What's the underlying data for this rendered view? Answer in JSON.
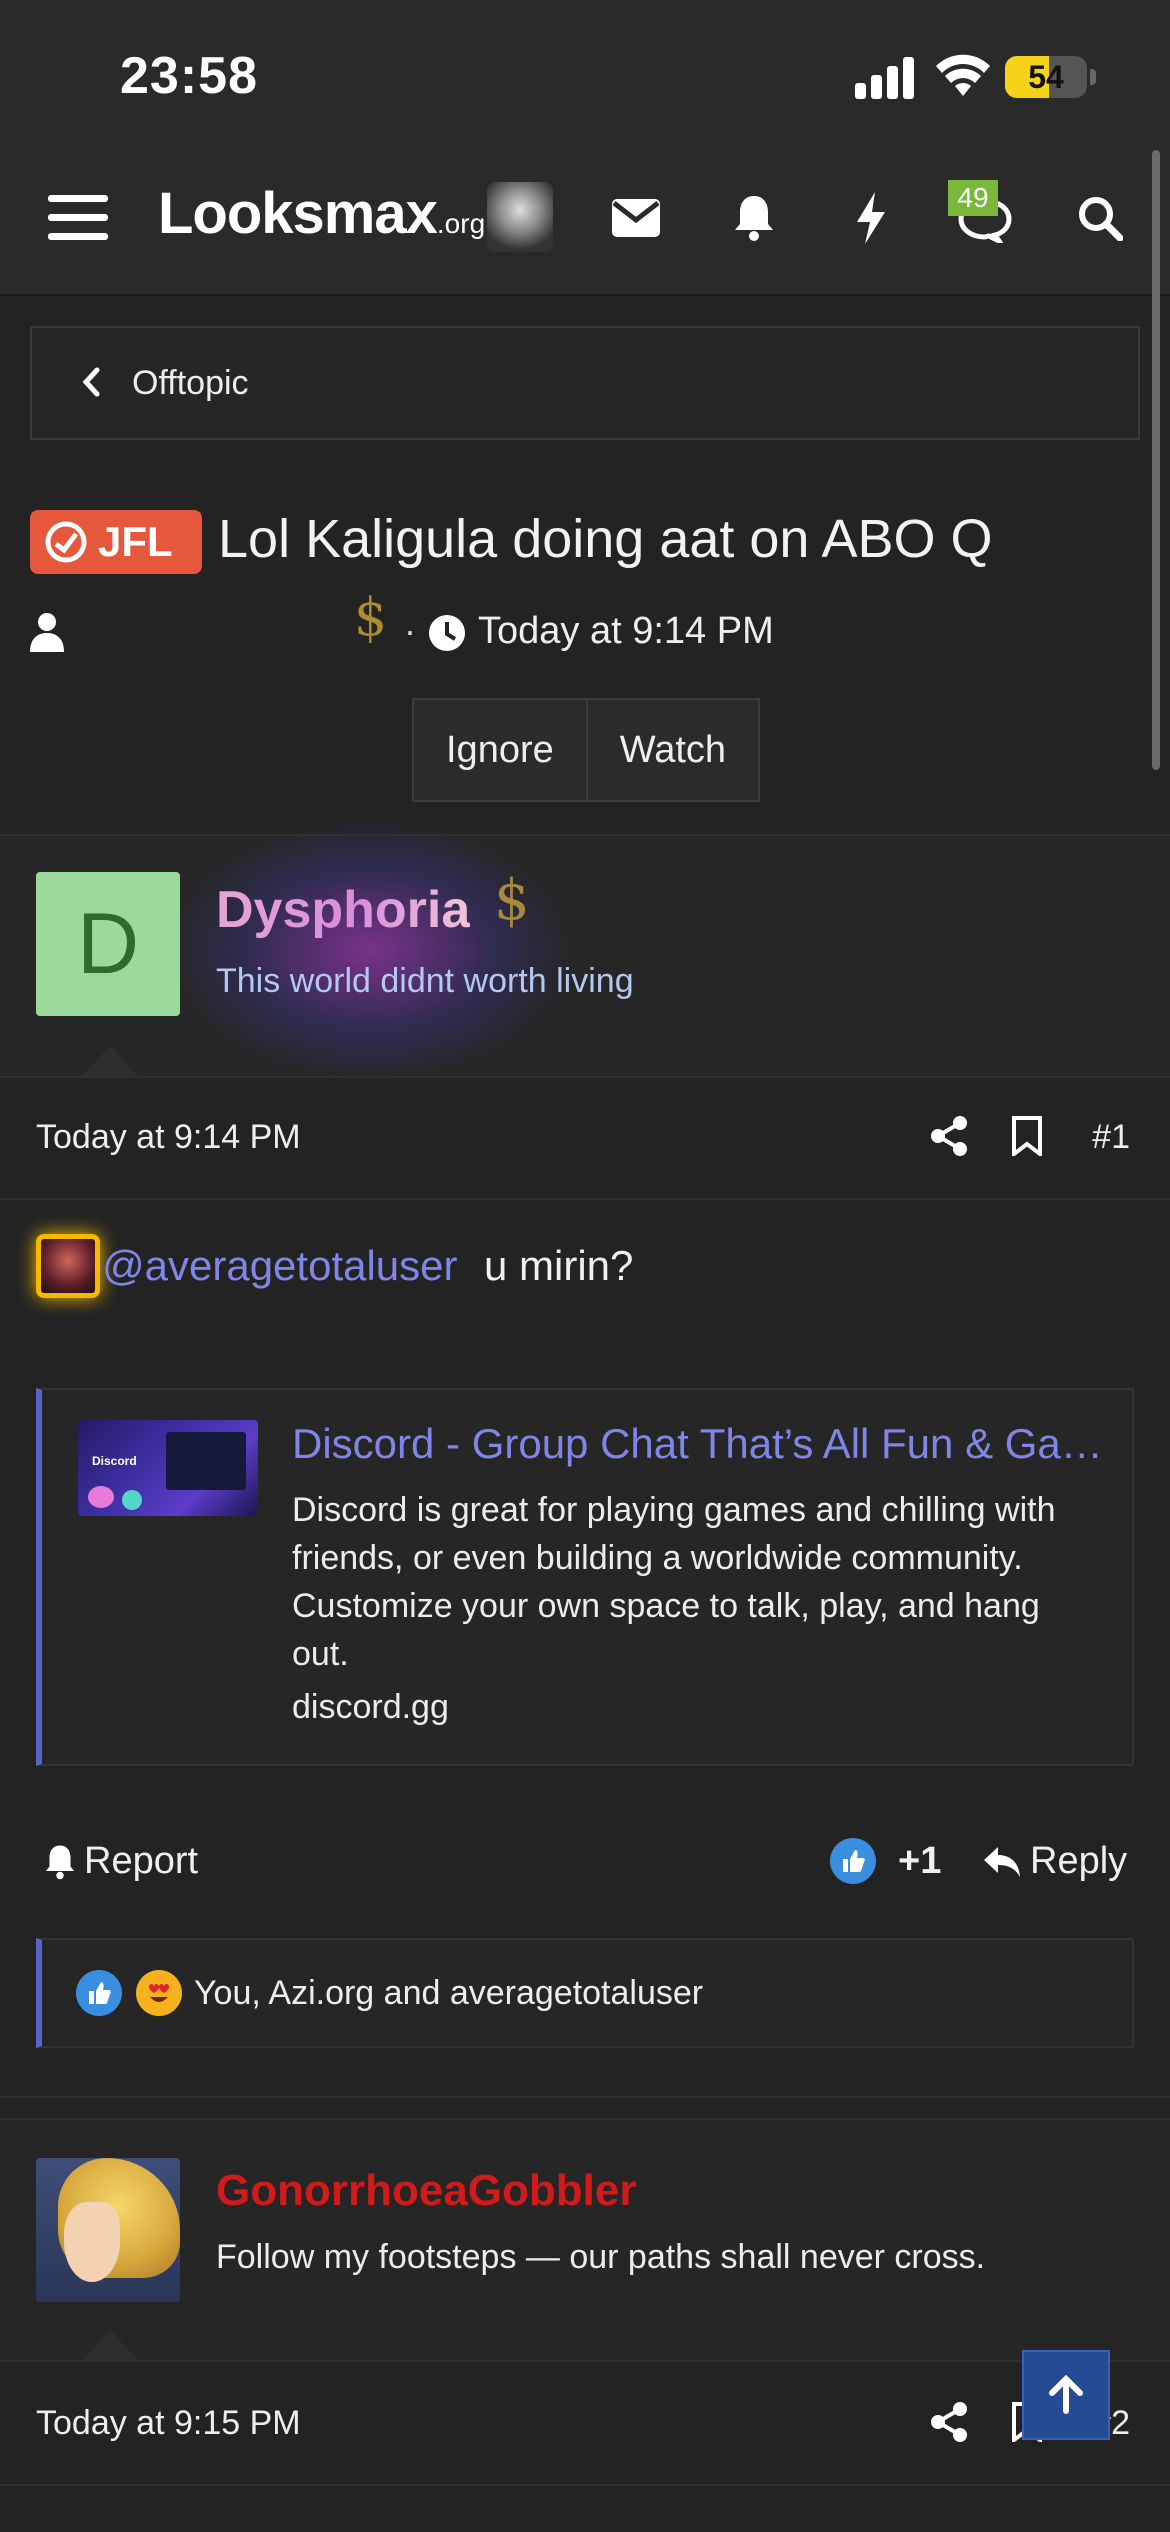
{
  "status_bar": {
    "time": "23:58",
    "battery": "54",
    "battery_level": 0.54
  },
  "nav": {
    "logo_main": "Looksmax",
    "logo_suffix": ".org",
    "conversations_badge": "49",
    "icons": [
      "menu-icon",
      "user-avatar",
      "mail-icon",
      "bell-icon",
      "bolt-icon",
      "chat-icon",
      "search-icon"
    ]
  },
  "breadcrumb": {
    "label": "Offtopic"
  },
  "thread": {
    "prefix": "JFL",
    "title": "Lol Kaligula doing aat on ABO Q",
    "meta_separator": "·",
    "meta_time": "Today at 9:14 PM",
    "buttons": {
      "ignore": "Ignore",
      "watch": "Watch"
    }
  },
  "posts": [
    {
      "avatar_letter": "D",
      "username": "Dysphoria",
      "user_title": "This world didnt worth living",
      "date": "Today at 9:14 PM",
      "number": "#1",
      "mention": "@averagetotaluser",
      "body_text": "u mirin?",
      "embed": {
        "title": "Discord - Group Chat That’s All Fun & Games",
        "description": "Discord is great for playing games and chilling with friends, or even building a worldwide community. Customize your own space to talk, play, and hang out.",
        "domain": "discord.gg",
        "thumb_label": "Discord"
      },
      "actions": {
        "report": "Report",
        "like_count": "+1",
        "reply": "Reply"
      },
      "reactions_text": "You, Azi.org and averagetotaluser"
    },
    {
      "username": "GonorrhoeaGobbler",
      "user_title": "Follow my footsteps — our paths shall never cross.",
      "date": "Today at 9:15 PM",
      "number": "#2"
    }
  ],
  "colors": {
    "background": "#232323",
    "header": "#2a2a2a",
    "jfl_prefix": "#e5583c",
    "link": "#7f86e8",
    "username_2": "#d11a1a",
    "badge_green": "#79b83a",
    "scroll_top": "#264b95"
  }
}
